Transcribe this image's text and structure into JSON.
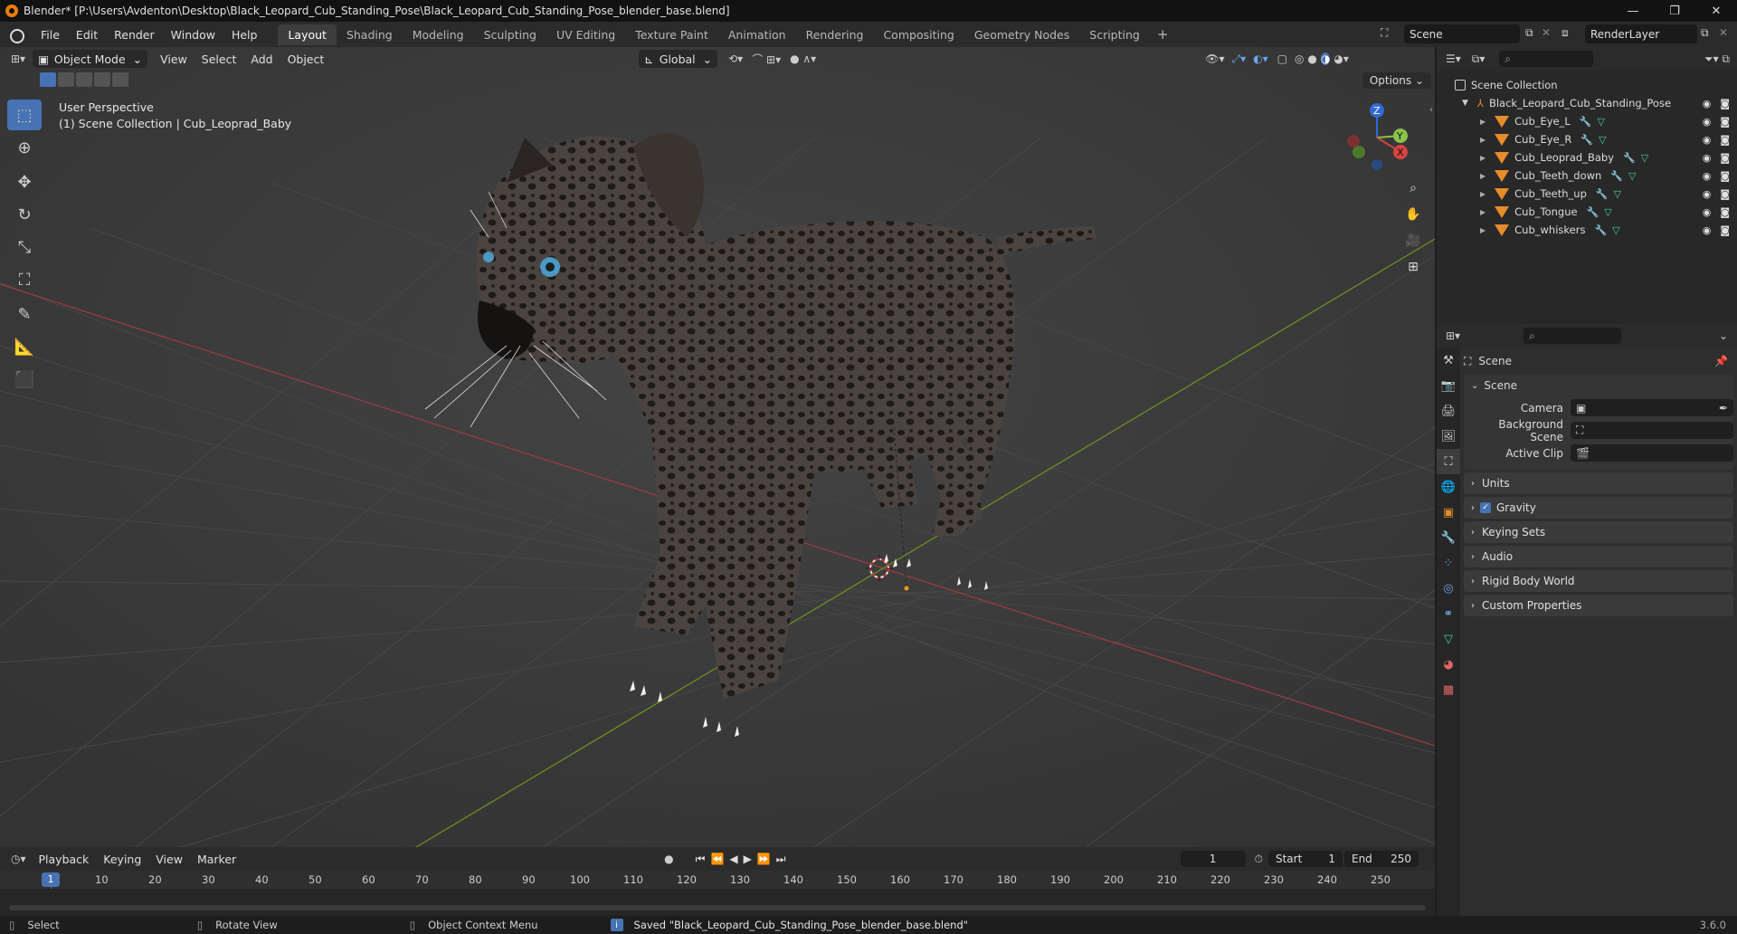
{
  "window": {
    "title": "Blender* [P:\\Users\\Avdenton\\Desktop\\Black_Leopard_Cub_Standing_Pose\\Black_Leopard_Cub_Standing_Pose_blender_base.blend]"
  },
  "menu": [
    "File",
    "Edit",
    "Render",
    "Window",
    "Help"
  ],
  "workspaces": [
    "Layout",
    "Shading",
    "Modeling",
    "Sculpting",
    "UV Editing",
    "Texture Paint",
    "Animation",
    "Rendering",
    "Compositing",
    "Geometry Nodes",
    "Scripting"
  ],
  "active_workspace": "Layout",
  "scene_name": "Scene",
  "render_layer": "RenderLayer",
  "viewport": {
    "mode": "Object Mode",
    "menus": [
      "View",
      "Select",
      "Add",
      "Object"
    ],
    "transform_orientation": "Global",
    "options_label": "Options",
    "info_line1": "User Perspective",
    "info_line2": "(1) Scene Collection | Cub_Leoprad_Baby"
  },
  "outliner": {
    "root": "Scene Collection",
    "collection": "Black_Leopard_Cub_Standing_Pose",
    "objects": [
      "Cub_Eye_L",
      "Cub_Eye_R",
      "Cub_Leoprad_Baby",
      "Cub_Teeth_down",
      "Cub_Teeth_up",
      "Cub_Tongue",
      "Cub_whiskers"
    ]
  },
  "properties": {
    "header": "Scene",
    "section": "Scene",
    "fields": [
      {
        "label": "Camera",
        "value": ""
      },
      {
        "label": "Background Scene",
        "value": ""
      },
      {
        "label": "Active Clip",
        "value": ""
      }
    ],
    "panels": [
      "Units",
      "Gravity",
      "Keying Sets",
      "Audio",
      "Rigid Body World",
      "Custom Properties"
    ]
  },
  "timeline": {
    "menus": [
      "Playback",
      "Keying",
      "View",
      "Marker"
    ],
    "current_frame": "1",
    "start_label": "Start",
    "start": "1",
    "end_label": "End",
    "end": "250",
    "ticks": [
      "1",
      "10",
      "20",
      "30",
      "40",
      "50",
      "60",
      "70",
      "80",
      "90",
      "100",
      "110",
      "120",
      "130",
      "140",
      "150",
      "160",
      "170",
      "180",
      "190",
      "200",
      "210",
      "220",
      "230",
      "240",
      "250"
    ]
  },
  "status": {
    "select": "Select",
    "rotate": "Rotate View",
    "context": "Object Context Menu",
    "message": "Saved \"Black_Leopard_Cub_Standing_Pose_blender_base.blend\"",
    "version": "3.6.0"
  }
}
